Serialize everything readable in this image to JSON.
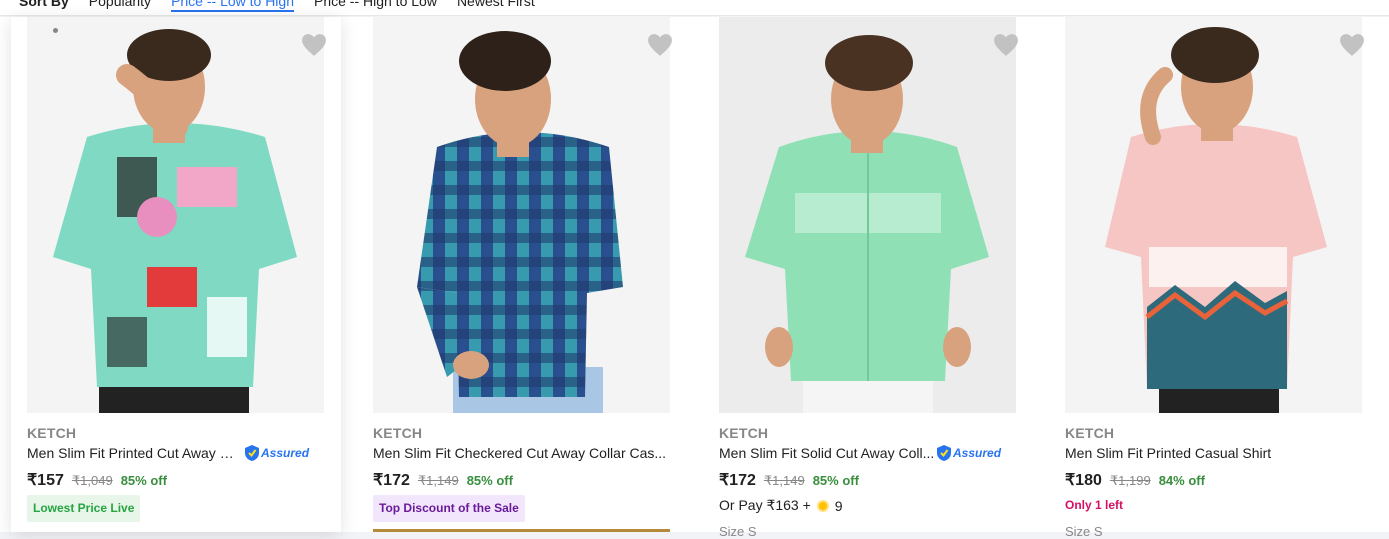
{
  "sort": {
    "label": "Sort By",
    "options": [
      {
        "label": "Popularity",
        "active": false
      },
      {
        "label": "Price -- Low to High",
        "active": true
      },
      {
        "label": "Price -- High to Low",
        "active": false
      },
      {
        "label": "Newest First",
        "active": false
      }
    ]
  },
  "products": [
    {
      "brand": "KETCH",
      "title": "Men Slim Fit Printed Cut Away C...",
      "assured": "Assured",
      "price": "₹157",
      "mrp": "₹1,049",
      "discount": "85% off",
      "badge": "Lowest Price Live",
      "shirt_color": "#7fd9c3"
    },
    {
      "brand": "KETCH",
      "title": "Men Slim Fit Checkered Cut Away Collar Cas...",
      "price": "₹172",
      "mrp": "₹1,149",
      "discount": "85% off",
      "badge": "Top Discount of the Sale",
      "shirt_color": "#2a4f8f"
    },
    {
      "brand": "KETCH",
      "title": "Men Slim Fit Solid Cut Away Coll...",
      "assured": "Assured",
      "price": "₹172",
      "mrp": "₹1,149",
      "discount": "85% off",
      "pay_later": "Or Pay ₹163 +",
      "coins": "9",
      "size_text": "Size S",
      "shirt_color": "#8fe0b4"
    },
    {
      "brand": "KETCH",
      "title": "Men Slim Fit Printed Casual Shirt",
      "price": "₹180",
      "mrp": "₹1,199",
      "discount": "84% off",
      "stock_note": "Only 1 left",
      "size_text": "Size S",
      "shirt_color": "#f6c6c4"
    }
  ],
  "colors": {
    "accent": "#2874f0",
    "discount": "#388e3c",
    "muted": "#878787",
    "heart": "#c2c2c2"
  }
}
